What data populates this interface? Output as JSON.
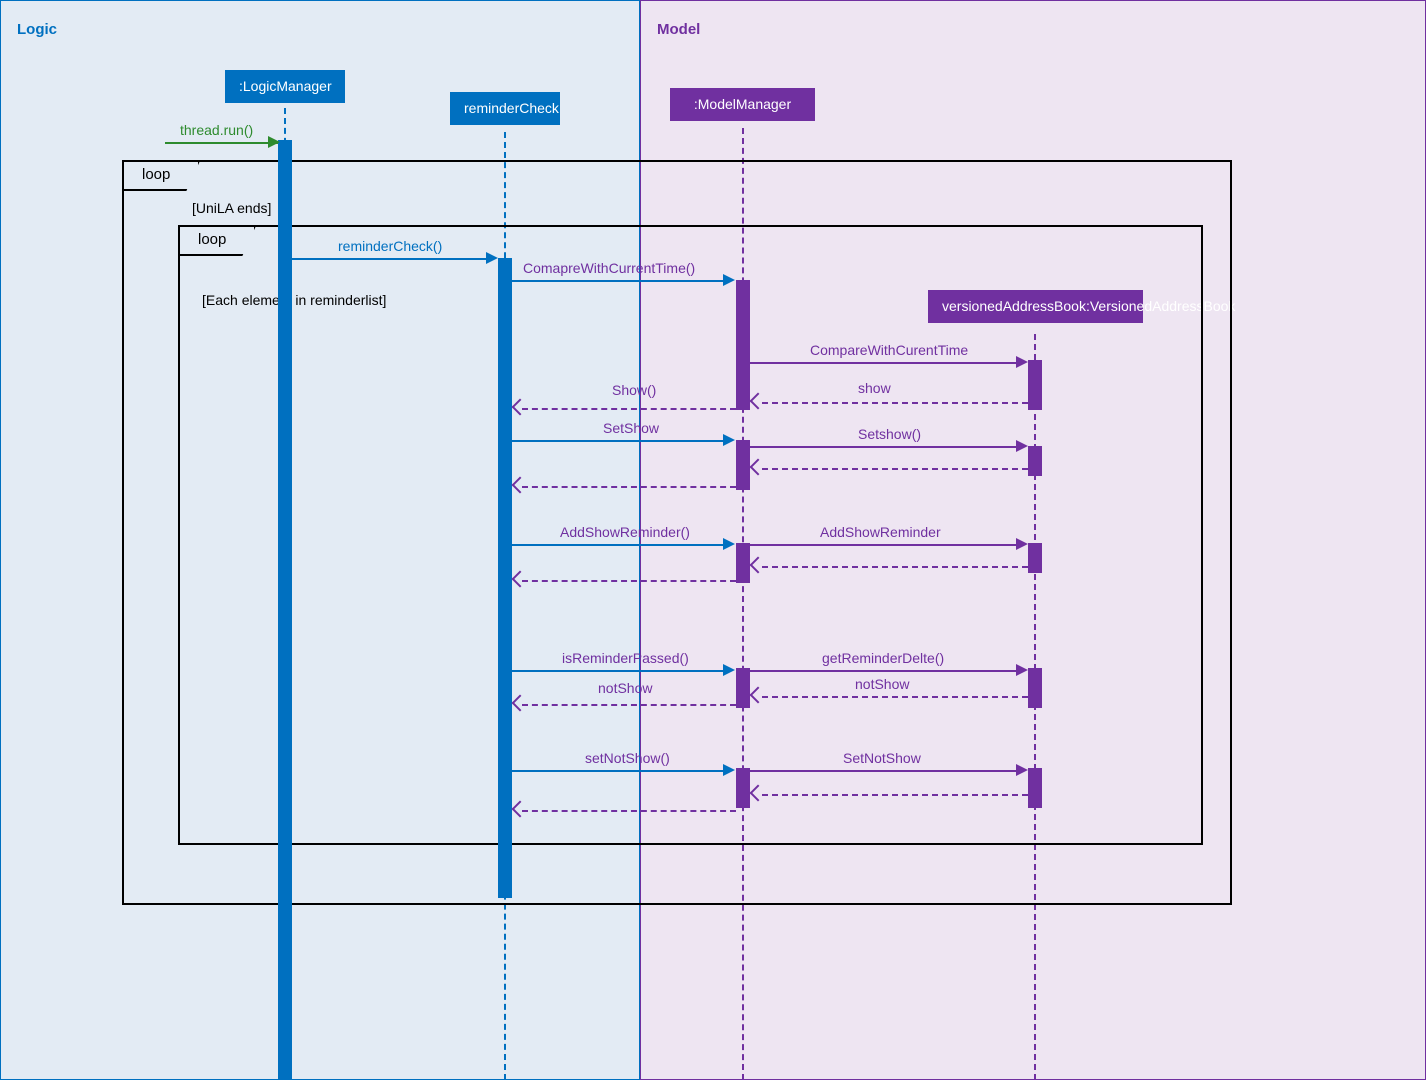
{
  "regions": {
    "logic": {
      "label": "Logic"
    },
    "model": {
      "label": "Model"
    }
  },
  "participants": {
    "logicManager": {
      "label": ":LogicManager"
    },
    "reminderCheck": {
      "label": "reminderCheck"
    },
    "modelManager": {
      "label": ":ModelManager"
    },
    "versionedAddressBook": {
      "label": "versionedAddressBook:VersionedAddressBook"
    }
  },
  "frames": {
    "outerLoop": {
      "title": "loop",
      "condition": "[UniLA ends]"
    },
    "innerLoop": {
      "title": "loop",
      "condition": "[Each element in reminderlist]"
    }
  },
  "messages": {
    "threadRun": "thread.run()",
    "reminderCheckCall": "reminderCheck()",
    "compareWithCurrentTime": "ComapreWithCurrentTime()",
    "compareWithCurentTime2": "CompareWithCurentTime",
    "show": "Show()",
    "showReturn": "show",
    "setShow": "SetShow",
    "setshowCall": "Setshow()",
    "addShowReminder": "AddShowReminder()",
    "addShowReminder2": "AddShowReminder",
    "isReminderPassed": "isReminderPassed()",
    "getReminderDelete": "getReminderDelte()",
    "notShow": "notShow",
    "notShow2": "notShow",
    "setNotShow": "setNotShow()",
    "setNotShow2": "SetNotShow"
  }
}
